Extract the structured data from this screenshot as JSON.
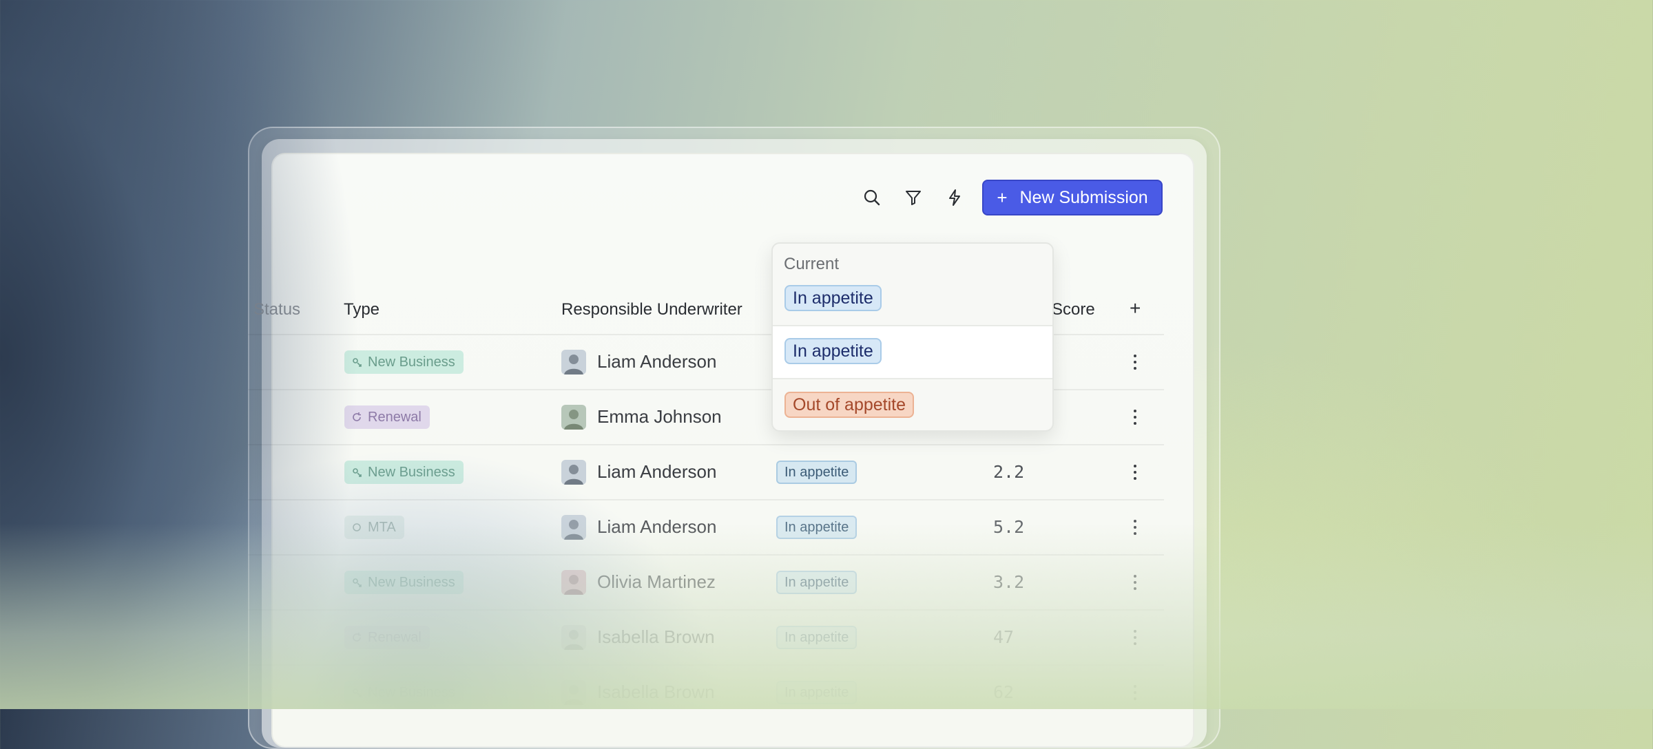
{
  "toolbar": {
    "search_icon": "search-icon",
    "filter_icon": "filter-icon",
    "automation_icon": "lightning-icon",
    "new_submission_label": "New Submission",
    "accent_color": "#4a5be6"
  },
  "table": {
    "columns": {
      "status": "Status",
      "type": "Type",
      "underwriter": "Responsible Underwriter",
      "score": "Score",
      "add": "+"
    },
    "rows": [
      {
        "type": "New Business",
        "type_kind": "nb",
        "underwriter": "Liam Anderson",
        "appetite": "",
        "score": ""
      },
      {
        "type": "Renewal",
        "type_kind": "rn",
        "underwriter": "Emma Johnson",
        "appetite": "",
        "score": ""
      },
      {
        "type": "New Business",
        "type_kind": "nb",
        "underwriter": "Liam Anderson",
        "appetite": "In appetite",
        "score": "2.2"
      },
      {
        "type": "MTA",
        "type_kind": "mt",
        "underwriter": "Liam Anderson",
        "appetite": "In appetite",
        "score": "5.2"
      },
      {
        "type": "New Business",
        "type_kind": "nb",
        "underwriter": "Olivia Martinez",
        "appetite": "In appetite",
        "score": "3.2"
      },
      {
        "type": "Renewal",
        "type_kind": "rn",
        "underwriter": "Isabella Brown",
        "appetite": "In appetite",
        "score": "47"
      },
      {
        "type": "New Business",
        "type_kind": "nb",
        "underwriter": "Isabella Brown",
        "appetite": "In appetite",
        "score": "62"
      }
    ]
  },
  "dropdown": {
    "current_label": "Current",
    "current_value": "In appetite",
    "options": [
      "In appetite",
      "Out of appetite"
    ]
  }
}
